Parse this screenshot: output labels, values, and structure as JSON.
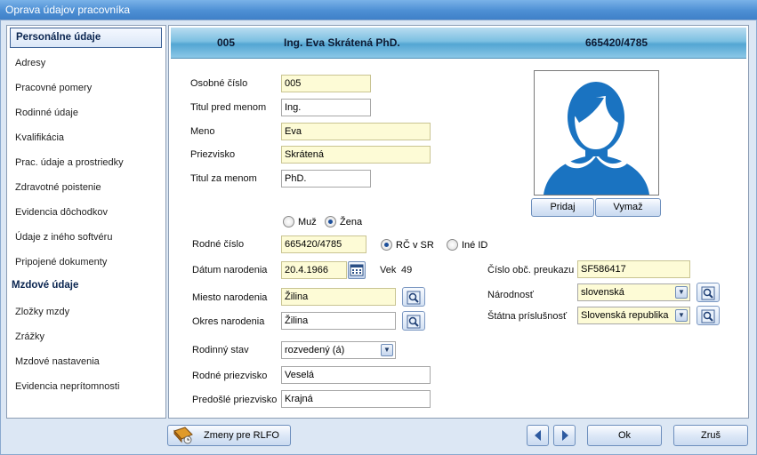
{
  "window": {
    "title": "Oprava údajov pracovníka"
  },
  "sidebar": {
    "items": [
      "Personálne údaje",
      "Adresy",
      "Pracovné pomery",
      "Rodinné údaje",
      "Kvalifikácia",
      "Prac. údaje a prostriedky",
      "Zdravotné poistenie",
      "Evidencia dôchodkov",
      "Údaje z iného softvéru",
      "Pripojené dokumenty"
    ],
    "group2": "Mzdové údaje",
    "items2": [
      "Zložky mzdy",
      "Zrážky",
      "Mzdové nastavenia",
      "Evidencia neprítomnosti"
    ]
  },
  "banner": {
    "number": "005",
    "name": "Ing. Eva Skrátená PhD.",
    "id": "665420/4785"
  },
  "form": {
    "osobne_cislo": {
      "label": "Osobné číslo",
      "value": "005"
    },
    "titul_pred": {
      "label": "Titul pred menom",
      "value": "Ing."
    },
    "meno": {
      "label": "Meno",
      "value": "Eva"
    },
    "priezvisko": {
      "label": "Priezvisko",
      "value": "Skrátená"
    },
    "titul_za": {
      "label": "Titul za menom",
      "value": "PhD."
    },
    "gender": {
      "male": "Muž",
      "female": "Žena",
      "selected": "female"
    },
    "rodne_cislo": {
      "label": "Rodné číslo",
      "value": "665420/4785"
    },
    "id_type": {
      "opt1": "RČ v SR",
      "opt2": "Iné ID",
      "selected": "opt1"
    },
    "datum_narodenia": {
      "label": "Dátum narodenia",
      "value": "20.4.1966"
    },
    "vek": {
      "label": "Vek",
      "value": "49"
    },
    "miesto_narodenia": {
      "label": "Miesto narodenia",
      "value": "Žilina"
    },
    "okres_narodenia": {
      "label": "Okres narodenia",
      "value": "Žilina"
    },
    "rodinny_stav": {
      "label": "Rodinný stav",
      "value": "rozvedený (á)"
    },
    "rodne_priezvisko": {
      "label": "Rodné priezvisko",
      "value": "Veselá"
    },
    "predosle_priezvisko": {
      "label": "Predošlé priezvisko",
      "value": "Krajná"
    },
    "cislo_op": {
      "label": "Číslo obč. preukazu",
      "value": "SF586417"
    },
    "narodnost": {
      "label": "Národnosť",
      "value": "slovenská"
    },
    "statna_prislusnost": {
      "label": "Štátna príslušnosť",
      "value": "Slovenská republika"
    }
  },
  "photo": {
    "add": "Pridaj",
    "delete": "Vymaž",
    "icon": "person-silhouette",
    "color": "#1a73c1"
  },
  "footer": {
    "rlfo": "Zmeny pre RLFO",
    "ok": "Ok",
    "cancel": "Zruš"
  },
  "colors": {
    "accent": "#1a73c1",
    "required_bg": "#fdfbd6"
  }
}
